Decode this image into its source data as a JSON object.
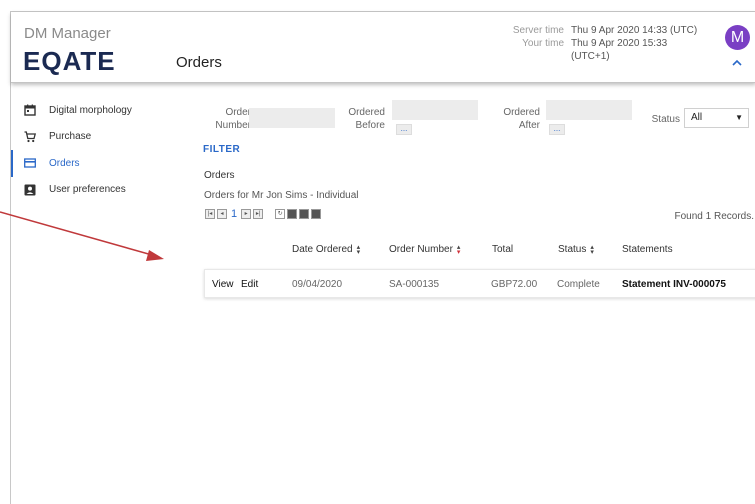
{
  "header": {
    "app_name": "DM Manager",
    "logo": "EQATE",
    "page_title": "Orders",
    "server_time_label": "Server time",
    "server_time_value": "Thu 9 Apr 2020 14:33 (UTC)",
    "your_time_label": "Your time",
    "your_time_value": "Thu 9 Apr 2020 15:33 (UTC+1)",
    "avatar_initial": "M",
    "collapse_icon": "chevron-up-icon"
  },
  "sidebar": {
    "items": [
      {
        "label": "Digital morphology",
        "icon": "calendar-icon"
      },
      {
        "label": "Purchase",
        "icon": "cart-icon"
      },
      {
        "label": "Orders",
        "icon": "card-icon",
        "active": true
      },
      {
        "label": "User preferences",
        "icon": "account-box-icon"
      }
    ]
  },
  "filters": {
    "order_number_label_1": "Order",
    "order_number_label_2": "Number",
    "ordered_before_label_1": "Ordered",
    "ordered_before_label_2": "Before",
    "ordered_after_label_1": "Ordered",
    "ordered_after_label_2": "After",
    "dots": "...",
    "status_label": "Status",
    "status_value": "All",
    "filter_button": "FILTER"
  },
  "orders": {
    "title": "Orders",
    "subtitle": "Orders for Mr Jon Sims - Individual",
    "page_number": "1",
    "found_text": "Found 1 Records.",
    "columns": [
      "Date Ordered",
      "Order Number",
      "Total",
      "Status",
      "Statements"
    ],
    "rows": [
      {
        "view": "View",
        "edit": "Edit",
        "date": "09/04/2020",
        "number": "SA-000135",
        "total": "GBP72.00",
        "status": "Complete",
        "statement": "Statement INV-000075"
      }
    ]
  },
  "colors": {
    "accent": "#2a68c8",
    "logo": "#1b2a52",
    "avatar": "#7a3fc4",
    "arrow": "#c0393b"
  }
}
